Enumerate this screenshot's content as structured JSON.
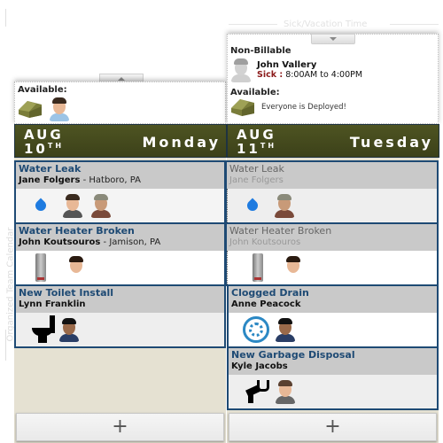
{
  "side_label": "Organized Team Calendar",
  "sick_vacation_label": "Sick/Vacation Time",
  "days": [
    {
      "month": "AUG",
      "day_num": "10",
      "day_suffix": "TH",
      "weekday": "Monday",
      "availability": {
        "available_label": "Available:",
        "available_icons": [
          "tent-icon",
          "technician-avatar"
        ]
      },
      "jobs": [
        {
          "title": "Water Leak",
          "customer": "Jane Folgers",
          "location": " - Hatboro, PA",
          "icons": [
            "water-drop-icon",
            "technician-avatar",
            "technician-avatar"
          ]
        },
        {
          "title": "Water Heater Broken",
          "customer": "John Koutsouros",
          "location": " - Jamison, PA",
          "icons": [
            "water-heater-icon",
            "technician-avatar"
          ]
        },
        {
          "title": "New Toilet Install",
          "customer": "Lynn Franklin",
          "location": "",
          "icons": [
            "toilet-icon",
            "technician-avatar"
          ]
        }
      ],
      "add_label": "+"
    },
    {
      "month": "AUG",
      "day_num": "11",
      "day_suffix": "TH",
      "weekday": "Tuesday",
      "availability": {
        "non_billable_label": "Non-Billable",
        "non_billable_person": "John Vallery",
        "non_billable_reason": "Sick :",
        "non_billable_time": "8:00AM to 4:00PM",
        "available_label": "Available:",
        "available_message": "Everyone is Deployed!"
      },
      "jobs": [
        {
          "title": "Water Leak",
          "customer": "Jane Folgers",
          "continued": true,
          "icons": [
            "water-drop-icon",
            "technician-avatar"
          ]
        },
        {
          "title": "Water Heater Broken",
          "customer": "John Koutsouros",
          "continued": true,
          "icons": [
            "water-heater-icon",
            "technician-avatar"
          ]
        },
        {
          "title": "Clogged Drain",
          "customer": "Anne Peacock",
          "icons": [
            "drain-icon",
            "technician-avatar"
          ]
        },
        {
          "title": "New Garbage Disposal",
          "customer": "Kyle Jacobs",
          "icons": [
            "wrench-icon",
            "technician-avatar"
          ]
        }
      ],
      "add_label": "+"
    }
  ],
  "colors": {
    "date_bar": "#4a5020",
    "job_border": "#1e4a74",
    "sick_red": "#8b1a1a",
    "drop_blue": "#1e7be0"
  }
}
